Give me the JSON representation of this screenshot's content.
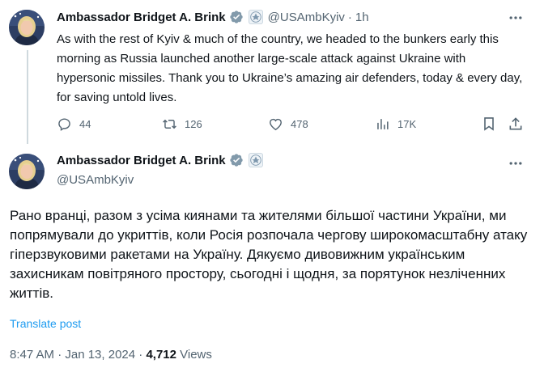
{
  "tweet1": {
    "author_name": "Ambassador Bridget A. Brink",
    "handle": "@USAmbKyiv",
    "separator": "·",
    "time": "1h",
    "text": "As with the rest of Kyiv & much of the country, we headed to the bunkers early this morning as Russia launched another large-scale attack against Ukraine with hypersonic missiles. Thank you to Ukraine’s amazing air defenders, today & every day, for saving untold lives.",
    "replies": "44",
    "reposts": "126",
    "likes": "478",
    "views": "17K"
  },
  "tweet2": {
    "author_name": "Ambassador Bridget A. Brink",
    "handle": "@USAmbKyiv",
    "text": "Рано вранці, разом з усіма киянами та жителями більшої частини України, ми попрямували до укриттів, коли Росія розпочала чергову широкомасштабну атаку гіперзвуковими ракетами на Україну. Дякуємо дивовижним українським захисникам повітряного простору, сьогодні і щодня, за порятунок незліченних життів.",
    "translate_label": "Translate post",
    "timestamp": "8:47 AM · Jan 13, 2024 · ",
    "views_count": "4,712",
    "views_label": " Views"
  },
  "icons": {
    "verified": "verified-badge-icon",
    "seal": "embassy-seal-icon",
    "more": "more-icon",
    "reply": "reply-icon",
    "repost": "repost-icon",
    "like": "like-icon",
    "views": "views-icon",
    "bookmark": "bookmark-icon",
    "share": "share-icon"
  },
  "colors": {
    "text": "#0f1419",
    "secondary": "#536471",
    "link": "#1d9bf0",
    "verified_badge": "#829aab",
    "thread_line": "#cfd9de"
  }
}
